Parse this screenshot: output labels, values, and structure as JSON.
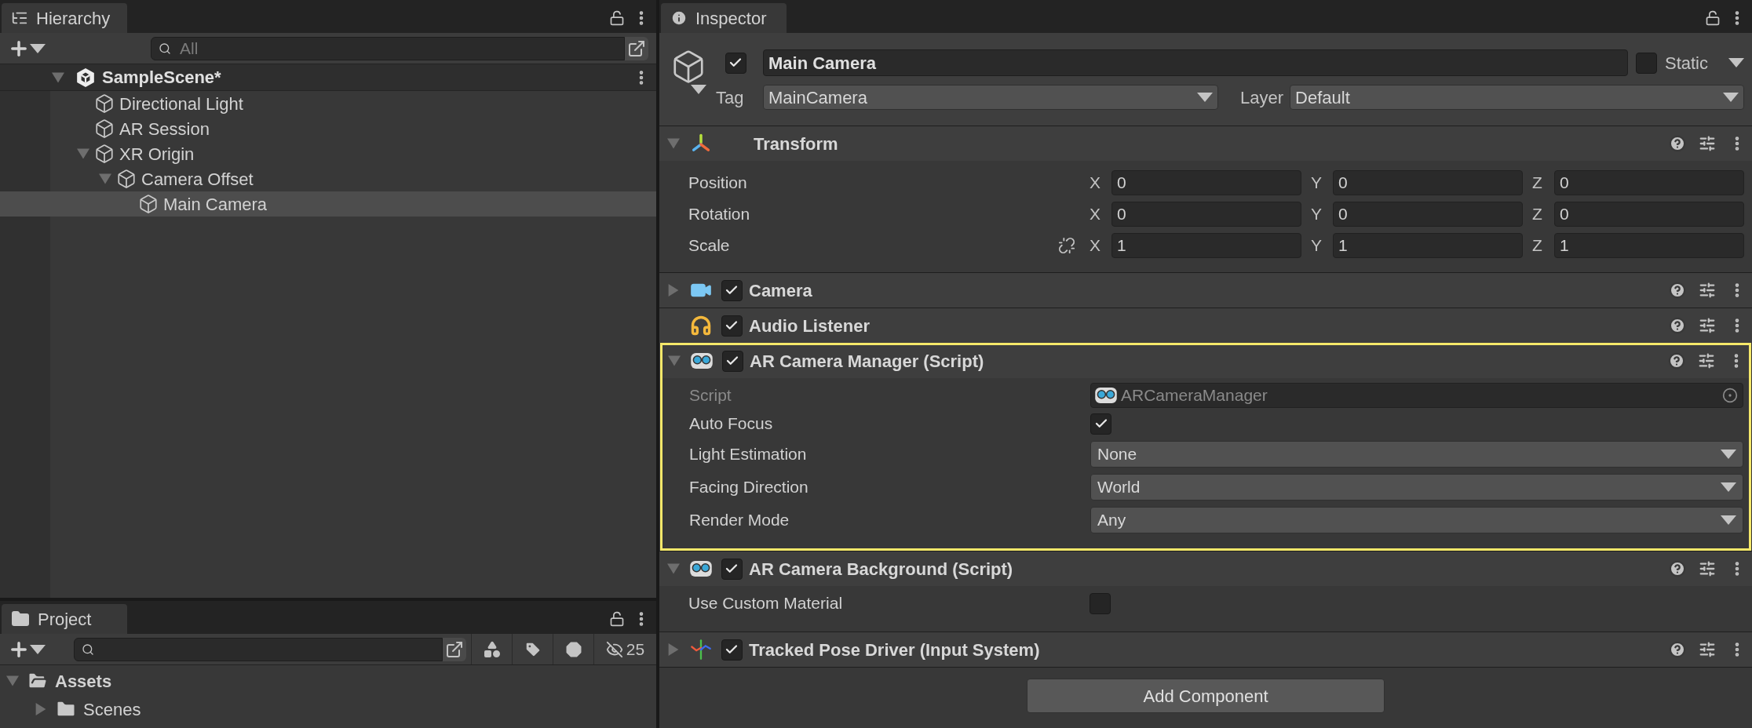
{
  "hierarchy": {
    "title": "Hierarchy",
    "search": {
      "placeholder": "All"
    },
    "scene": {
      "name": "SampleScene*",
      "expanded": true,
      "children": [
        {
          "name": "Directional Light",
          "selected": false
        },
        {
          "name": "AR Session",
          "selected": false
        },
        {
          "name": "XR Origin",
          "selected": false,
          "expanded": true,
          "children": [
            {
              "name": "Camera Offset",
              "selected": false,
              "expanded": true,
              "children": [
                {
                  "name": "Main Camera",
                  "selected": true
                }
              ]
            }
          ]
        }
      ]
    }
  },
  "project": {
    "title": "Project",
    "hidden_count": "25",
    "items": [
      {
        "name": "Assets",
        "expanded": true,
        "children": [
          {
            "name": "Scenes",
            "expanded": false
          }
        ]
      }
    ]
  },
  "inspector": {
    "title": "Inspector",
    "object": {
      "active": true,
      "name": "Main Camera",
      "static_label": "Static",
      "static": false,
      "tag_label": "Tag",
      "tag": "MainCamera",
      "layer_label": "Layer",
      "layer": "Default"
    },
    "components": [
      {
        "kind": "transform",
        "name": "Transform",
        "expanded": true,
        "highlighted": false,
        "rows": [
          {
            "label": "Position",
            "values": [
              {
                "axis": "X",
                "value": "0"
              },
              {
                "axis": "Y",
                "value": "0"
              },
              {
                "axis": "Z",
                "value": "0"
              }
            ]
          },
          {
            "label": "Rotation",
            "values": [
              {
                "axis": "X",
                "value": "0"
              },
              {
                "axis": "Y",
                "value": "0"
              },
              {
                "axis": "Z",
                "value": "0"
              }
            ]
          },
          {
            "label": "Scale",
            "constrained": false,
            "values": [
              {
                "axis": "X",
                "value": "1"
              },
              {
                "axis": "Y",
                "value": "1"
              },
              {
                "axis": "Z",
                "value": "1"
              }
            ]
          }
        ]
      },
      {
        "kind": "camera",
        "name": "Camera",
        "expanded": false,
        "enabled": true,
        "highlighted": false
      },
      {
        "kind": "audio",
        "name": "Audio Listener",
        "enabled": true,
        "highlighted": false
      },
      {
        "kind": "script",
        "name": "AR Camera Manager (Script)",
        "expanded": true,
        "enabled": true,
        "highlighted": true,
        "properties": [
          {
            "kind": "object",
            "label": "Script",
            "value": "ARCameraManager"
          },
          {
            "kind": "toggle",
            "label": "Auto Focus",
            "checked": true
          },
          {
            "kind": "dropdown",
            "label": "Light Estimation",
            "value": "None"
          },
          {
            "kind": "dropdown",
            "label": "Facing Direction",
            "value": "World"
          },
          {
            "kind": "dropdown",
            "label": "Render Mode",
            "value": "Any"
          }
        ]
      },
      {
        "kind": "script",
        "name": "AR Camera Background (Script)",
        "expanded": true,
        "enabled": true,
        "highlighted": false,
        "properties": [
          {
            "kind": "toggle",
            "label": "Use Custom Material",
            "checked": false
          }
        ]
      },
      {
        "kind": "pose",
        "name": "Tracked Pose Driver (Input System)",
        "expanded": false,
        "enabled": true,
        "highlighted": false
      }
    ],
    "add_button": "Add Component"
  }
}
